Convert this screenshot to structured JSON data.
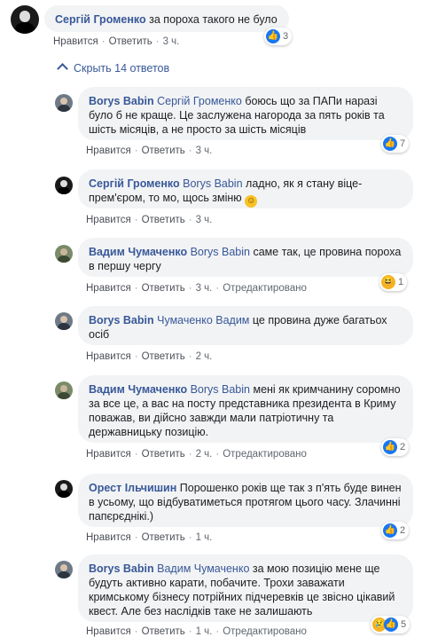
{
  "top_comment": {
    "author": "Сергій Громенко",
    "text": "за пороха такого не було",
    "like": "Нравится",
    "reply": "Ответить",
    "time": "3 ч.",
    "reaction_icon": "like-icon",
    "reaction_count": "3"
  },
  "hide_replies": {
    "label": "Скрыть 14 ответов",
    "icon": "chevron-up-icon"
  },
  "replies": [
    {
      "author": "Borys Babin",
      "mention": "Сергій Громенко",
      "text": "боюсь що за ПАПи наразі було б не краще. Це заслужена нагорода за пять років та шість місяців, а не просто за шість місяців",
      "like": "Нравится",
      "reply": "Ответить",
      "time": "3 ч.",
      "edited": "",
      "reaction_icon": "like-icon",
      "reaction_count": "7"
    },
    {
      "author": "Сергій Громенко",
      "mention": "Borys Babin",
      "text": "ладно, як я стану віце-прем'єром, то мо, щось зміню",
      "emoji": "smile-emoji",
      "like": "Нравится",
      "reply": "Ответить",
      "time": "3 ч.",
      "edited": ""
    },
    {
      "author": "Вадим Чумаченко",
      "mention": "Borys Babin",
      "text": "саме так, це провина пороха в першу чергу",
      "like": "Нравится",
      "reply": "Ответить",
      "time": "3 ч.",
      "edited": "Отредактировано",
      "reaction_icon": "haha-icon",
      "reaction_count": "1"
    },
    {
      "author": "Borys Babin",
      "mention": "Чумаченко Вадим",
      "text": "це провина дуже багатьох осіб",
      "like": "Нравится",
      "reply": "Ответить",
      "time": "2 ч.",
      "edited": ""
    },
    {
      "author": "Вадим Чумаченко",
      "mention": "Borys Babin",
      "text": "мені як кримчанину соромно за все це, а вас на посту представника президента в Криму поважав, ви дійсно завжди мали патріотичну та державницьку позицію.",
      "like": "Нравится",
      "reply": "Ответить",
      "time": "2 ч.",
      "edited": "Отредактировано",
      "reaction_icon": "like-icon",
      "reaction_count": "2"
    },
    {
      "author": "Орест Ільчишин",
      "mention": "",
      "text": "Порошенко років ще так з п'ять буде винен в усьому, що відбуватиметься протягом цього часу. Злачинні папєрєднікі.)",
      "like": "Нравится",
      "reply": "Ответить",
      "time": "1 ч.",
      "edited": "",
      "reaction_icon": "like-icon",
      "reaction_count": "2"
    },
    {
      "author": "Borys Babin",
      "mention": "Вадим Чумаченко",
      "text": "за мою позицію мене ще будуть активно карати, побачите. Трохи заважати кримському бізнесу потрійних підчеревків це звісно цікавий квест. Але без наслідків таке не залишають",
      "like": "Нравится",
      "reply": "Ответить",
      "time": "1 ч.",
      "edited": "Отредактировано",
      "reaction_icon": "sad-icon",
      "reaction_count": "5"
    }
  ]
}
